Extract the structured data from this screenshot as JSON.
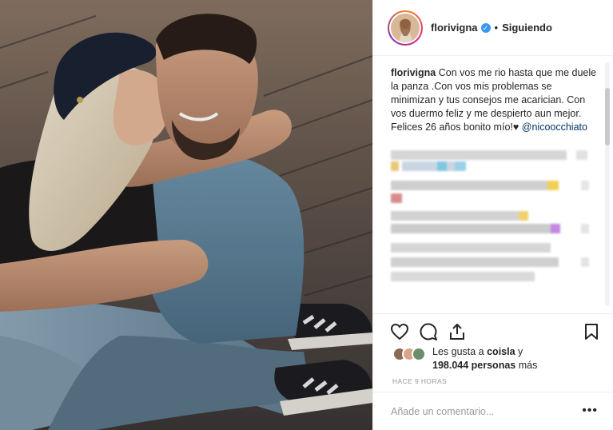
{
  "post": {
    "username": "florivigna",
    "verified_icon": "verified-badge-icon",
    "separator": "•",
    "follow_status": "Siguiendo"
  },
  "caption": {
    "username": "florivigna",
    "text": "Con vos me rio hasta que me duele la panza .Con vos mis problemas se minimizan y tus consejos me acarician. Con vos duermo feliz y me despierto aun mejor. Felices 26 años bonito mío!♥",
    "mention": "@nicoocchiato"
  },
  "actions": {
    "like_icon": "heart-icon",
    "comment_icon": "comment-icon",
    "share_icon": "share-icon",
    "save_icon": "bookmark-icon"
  },
  "likes": {
    "line1_prefix": "Les gusta a ",
    "line1_user": "coisla",
    "line1_suffix": " y",
    "line2_count": "198.044 personas",
    "line2_suffix": " más"
  },
  "timestamp": "HACE 9 HORAS",
  "add_comment": {
    "placeholder": "Añade un comentario...",
    "more_label": "•••"
  },
  "colors": {
    "verified": "#3897f0",
    "mention": "#003569",
    "muted": "#999999",
    "border": "#efefef"
  }
}
